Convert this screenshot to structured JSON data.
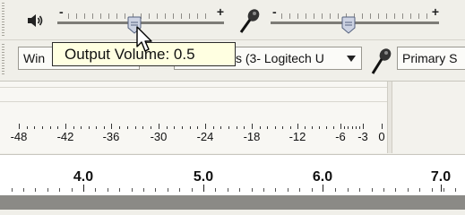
{
  "mixer": {
    "output_slider": {
      "minus": "-",
      "plus": "+",
      "value": 0.5
    },
    "input_slider": {
      "minus": "-",
      "plus": "+",
      "value": 0.5
    }
  },
  "tooltip": {
    "text": "Output Volume: 0.5"
  },
  "devices": {
    "host_label": "Win",
    "input_device_label": "s (3- Logitech U",
    "input_channels_label": "Primary S"
  },
  "meter": {
    "scale_labels": [
      "-48",
      "-42",
      "-36",
      "-30",
      "-24",
      "-18",
      "-12",
      "-6",
      "-3",
      "0"
    ]
  },
  "ruler": {
    "labels": [
      "4.0",
      "5.0",
      "6.0",
      "7.0"
    ]
  },
  "colors": {
    "toolbar_bg": "#f0efe9",
    "tooltip_bg": "#ffffe1",
    "ruler_bg": "#ffffff"
  }
}
